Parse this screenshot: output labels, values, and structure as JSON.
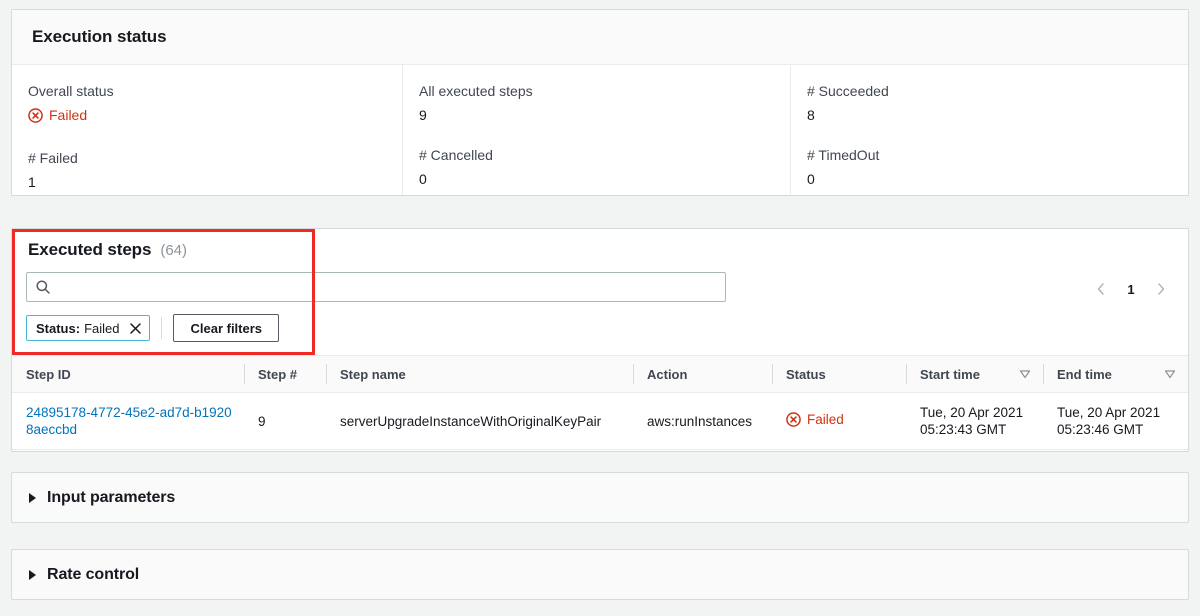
{
  "execution_status": {
    "title": "Execution status",
    "fields": [
      {
        "label": "Overall status",
        "value": "Failed",
        "type": "status-failed"
      },
      {
        "label": "All executed steps",
        "value": "9",
        "type": "text"
      },
      {
        "label": "# Succeeded",
        "value": "8",
        "type": "text"
      },
      {
        "label": "# Failed",
        "value": "1",
        "type": "text"
      },
      {
        "label": "# Cancelled",
        "value": "0",
        "type": "text"
      },
      {
        "label": "# TimedOut",
        "value": "0",
        "type": "text"
      }
    ]
  },
  "executed_steps": {
    "title": "Executed steps",
    "counter": "(64)",
    "search": {
      "value": "",
      "placeholder": "",
      "icon": "search-icon"
    },
    "filters": {
      "token": {
        "key": "Status:",
        "value": "Failed",
        "dismiss_icon": "close-icon"
      },
      "clear_button": "Clear filters"
    },
    "pagination": {
      "prev_icon": "chevron-left-icon",
      "page": "1",
      "next_icon": "chevron-right-icon"
    },
    "table": {
      "columns": [
        {
          "label": "Step ID",
          "sortable": false
        },
        {
          "label": "Step #",
          "sortable": false
        },
        {
          "label": "Step name",
          "sortable": false
        },
        {
          "label": "Action",
          "sortable": false
        },
        {
          "label": "Status",
          "sortable": false
        },
        {
          "label": "Start time",
          "sortable": true
        },
        {
          "label": "End time",
          "sortable": true
        }
      ],
      "rows": [
        {
          "step_id": "24895178-4772-45e2-ad7d-b19208aeccbd",
          "step_number": "9",
          "step_name": "serverUpgradeInstanceWithOriginalKeyPair",
          "action": "aws:runInstances",
          "status": "Failed",
          "start_time_line1": "Tue, 20 Apr 2021",
          "start_time_line2": "05:23:43 GMT",
          "end_time_line1": "Tue, 20 Apr 2021",
          "end_time_line2": "05:23:46 GMT"
        }
      ]
    }
  },
  "input_parameters": {
    "title": "Input parameters",
    "expand_icon": "caret-right-icon"
  },
  "rate_control": {
    "title": "Rate control",
    "expand_icon": "caret-right-icon"
  },
  "colors": {
    "error_red": "#d13212",
    "link_blue": "#0073bb",
    "annotation_red": "#ee2a23",
    "token_border": "#44b9d6",
    "page_background": "#f2f3f3"
  }
}
